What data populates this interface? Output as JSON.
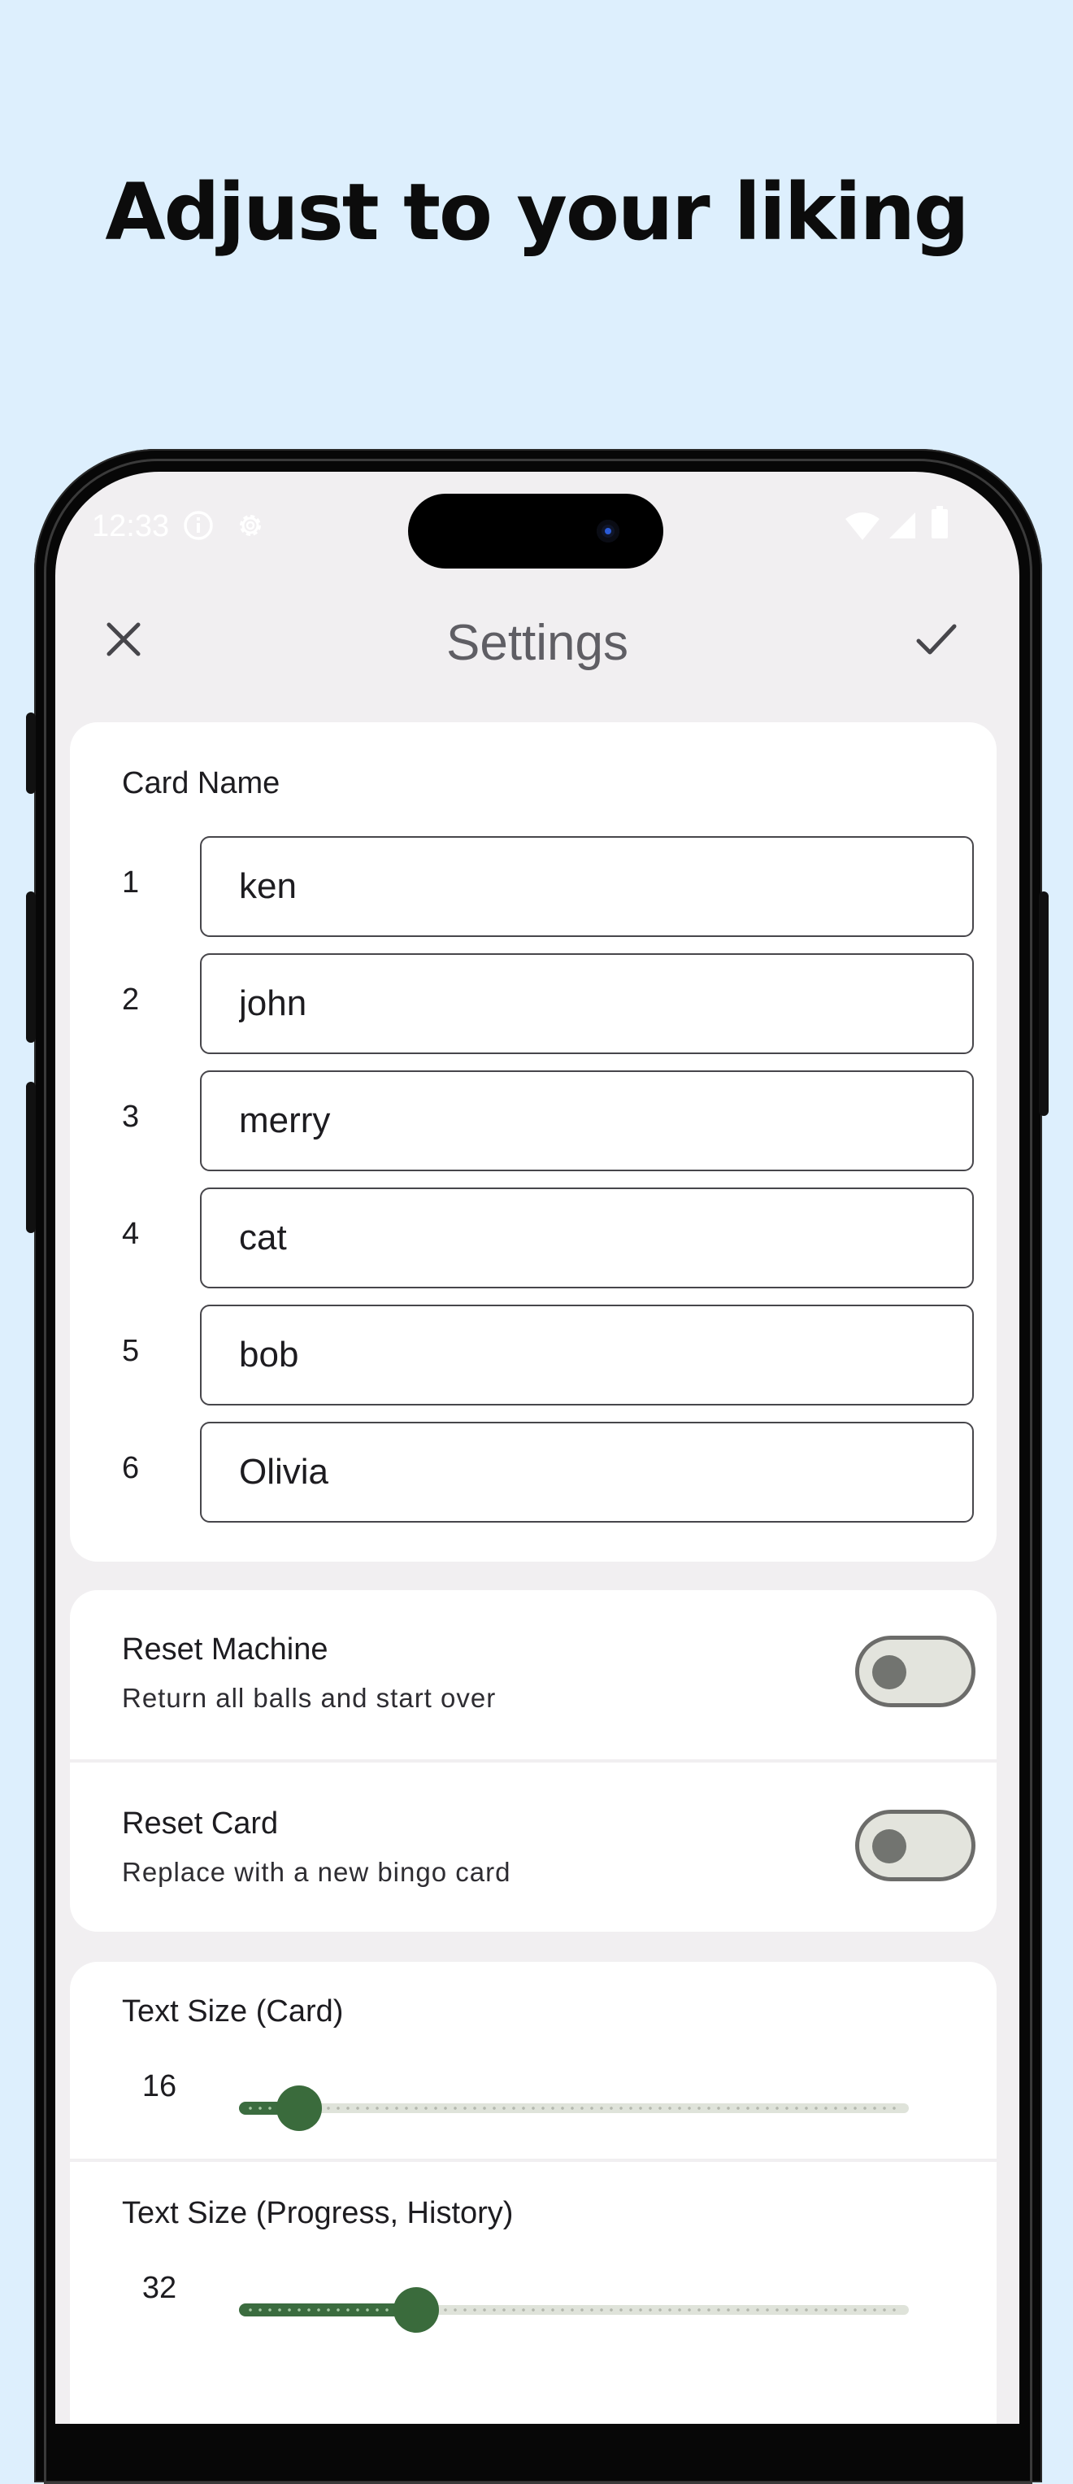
{
  "headline": "Adjust to your liking",
  "status_bar": {
    "time": "12:33",
    "left_icons": [
      "info-icon",
      "gear-icon"
    ],
    "right_icons": [
      "wifi-icon",
      "cell-signal-icon",
      "battery-icon"
    ]
  },
  "app_bar": {
    "title": "Settings",
    "close_icon": "close-icon",
    "confirm_icon": "check-icon"
  },
  "card_names": {
    "label": "Card Name",
    "rows": [
      {
        "number": "1",
        "value": "ken"
      },
      {
        "number": "2",
        "value": "john"
      },
      {
        "number": "3",
        "value": "merry"
      },
      {
        "number": "4",
        "value": "cat"
      },
      {
        "number": "5",
        "value": "bob"
      },
      {
        "number": "6",
        "value": "Olivia"
      }
    ]
  },
  "resets": [
    {
      "title": "Reset Machine",
      "subtitle": "Return all balls and start over",
      "on": false
    },
    {
      "title": "Reset Card",
      "subtitle": "Replace with a new bingo card",
      "on": false
    }
  ],
  "text_sizes": [
    {
      "title": "Text Size (Card)",
      "value": "16",
      "fraction": 0.09
    },
    {
      "title": "Text Size (Progress, History)",
      "value": "32",
      "fraction": 0.265
    }
  ],
  "colors": {
    "background": "#ddeffd",
    "screen": "#f1eff1",
    "accent_green": "#3a6b3c",
    "title_gray": "#5f5e64"
  }
}
